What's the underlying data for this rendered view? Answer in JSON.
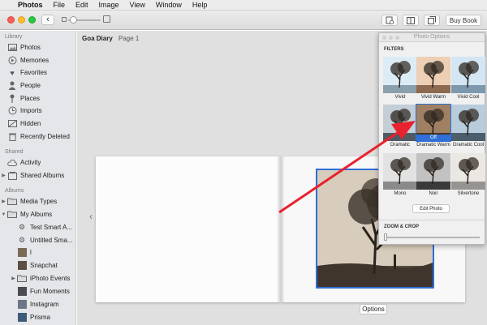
{
  "menubar": {
    "apple_glyph": "",
    "items": [
      "Photos",
      "File",
      "Edit",
      "Image",
      "View",
      "Window",
      "Help"
    ]
  },
  "toolbar": {
    "back_glyph": "‹",
    "buy_book_label": "Buy Book"
  },
  "sidebar": {
    "library_label": "Library",
    "library_items": [
      {
        "label": "Photos",
        "icon": "photos-icon"
      },
      {
        "label": "Memories",
        "icon": "memories-icon"
      },
      {
        "label": "Favorites",
        "icon": "heart-icon"
      },
      {
        "label": "People",
        "icon": "person-icon"
      },
      {
        "label": "Places",
        "icon": "pin-icon"
      },
      {
        "label": "Imports",
        "icon": "clock-icon"
      },
      {
        "label": "Hidden",
        "icon": "hidden-icon"
      },
      {
        "label": "Recently Deleted",
        "icon": "trash-icon"
      }
    ],
    "shared_label": "Shared",
    "shared_items": [
      {
        "label": "Activity",
        "icon": "cloud-icon"
      },
      {
        "label": "Shared Albums",
        "icon": "shared-album-icon"
      }
    ],
    "albums_label": "Albums",
    "album_items": [
      {
        "label": "Media Types",
        "icon": "folder-icon"
      },
      {
        "label": "My Albums",
        "icon": "folder-icon"
      },
      {
        "label": "Test Smart A...",
        "icon": "smart-album-icon"
      },
      {
        "label": "Untitled Sma...",
        "icon": "smart-album-icon"
      },
      {
        "label": "l",
        "icon": "album-icon"
      },
      {
        "label": "Snapchat",
        "icon": "album-icon"
      },
      {
        "label": "iPhoto Events",
        "icon": "folder-icon"
      },
      {
        "label": "Fun Moments",
        "icon": "album-icon"
      },
      {
        "label": "Instagram",
        "icon": "album-icon"
      },
      {
        "label": "Prisma",
        "icon": "album-icon"
      }
    ]
  },
  "main": {
    "book_title": "Goa Diary",
    "page_label": "Page 1",
    "options_label": "Options"
  },
  "photo_options": {
    "title": "Photo Options",
    "filters_label": "FILTERS",
    "filters": [
      {
        "label": "Vivid",
        "tone": "#dcecf6",
        "ground": "#8aa0ad"
      },
      {
        "label": "Vivid Warm",
        "tone": "#eccfb4",
        "ground": "#8d6a4f"
      },
      {
        "label": "Vivid Cool",
        "tone": "#d4e6f4",
        "ground": "#7d98ad"
      },
      {
        "label": "Dramatic",
        "tone": "#c3ced7",
        "ground": "#4f5a62"
      },
      {
        "label": "Dramatic Warm",
        "tone": "#a08063",
        "ground": "#4a3424"
      },
      {
        "label": "Dramatic Cool",
        "tone": "#b9ccdb",
        "ground": "#4c5d6c"
      },
      {
        "label": "Mono",
        "tone": "#e2e2e2",
        "ground": "#8a8a8a"
      },
      {
        "label": "Noir",
        "tone": "#c2c2c2",
        "ground": "#3a3a3a"
      },
      {
        "label": "Silvertone",
        "tone": "#ebe8e3",
        "ground": "#979390"
      }
    ],
    "selected_badge": "Off",
    "edit_photo_label": "Edit Photo",
    "zoom_crop_label": "ZOOM & CROP",
    "zoom_level": 0
  },
  "colors": {
    "accent": "#2f6fd6",
    "annotation_arrow": "#e8222e",
    "close": "#fc5f57",
    "minimize": "#fdbc2e",
    "zoom": "#28c840"
  }
}
